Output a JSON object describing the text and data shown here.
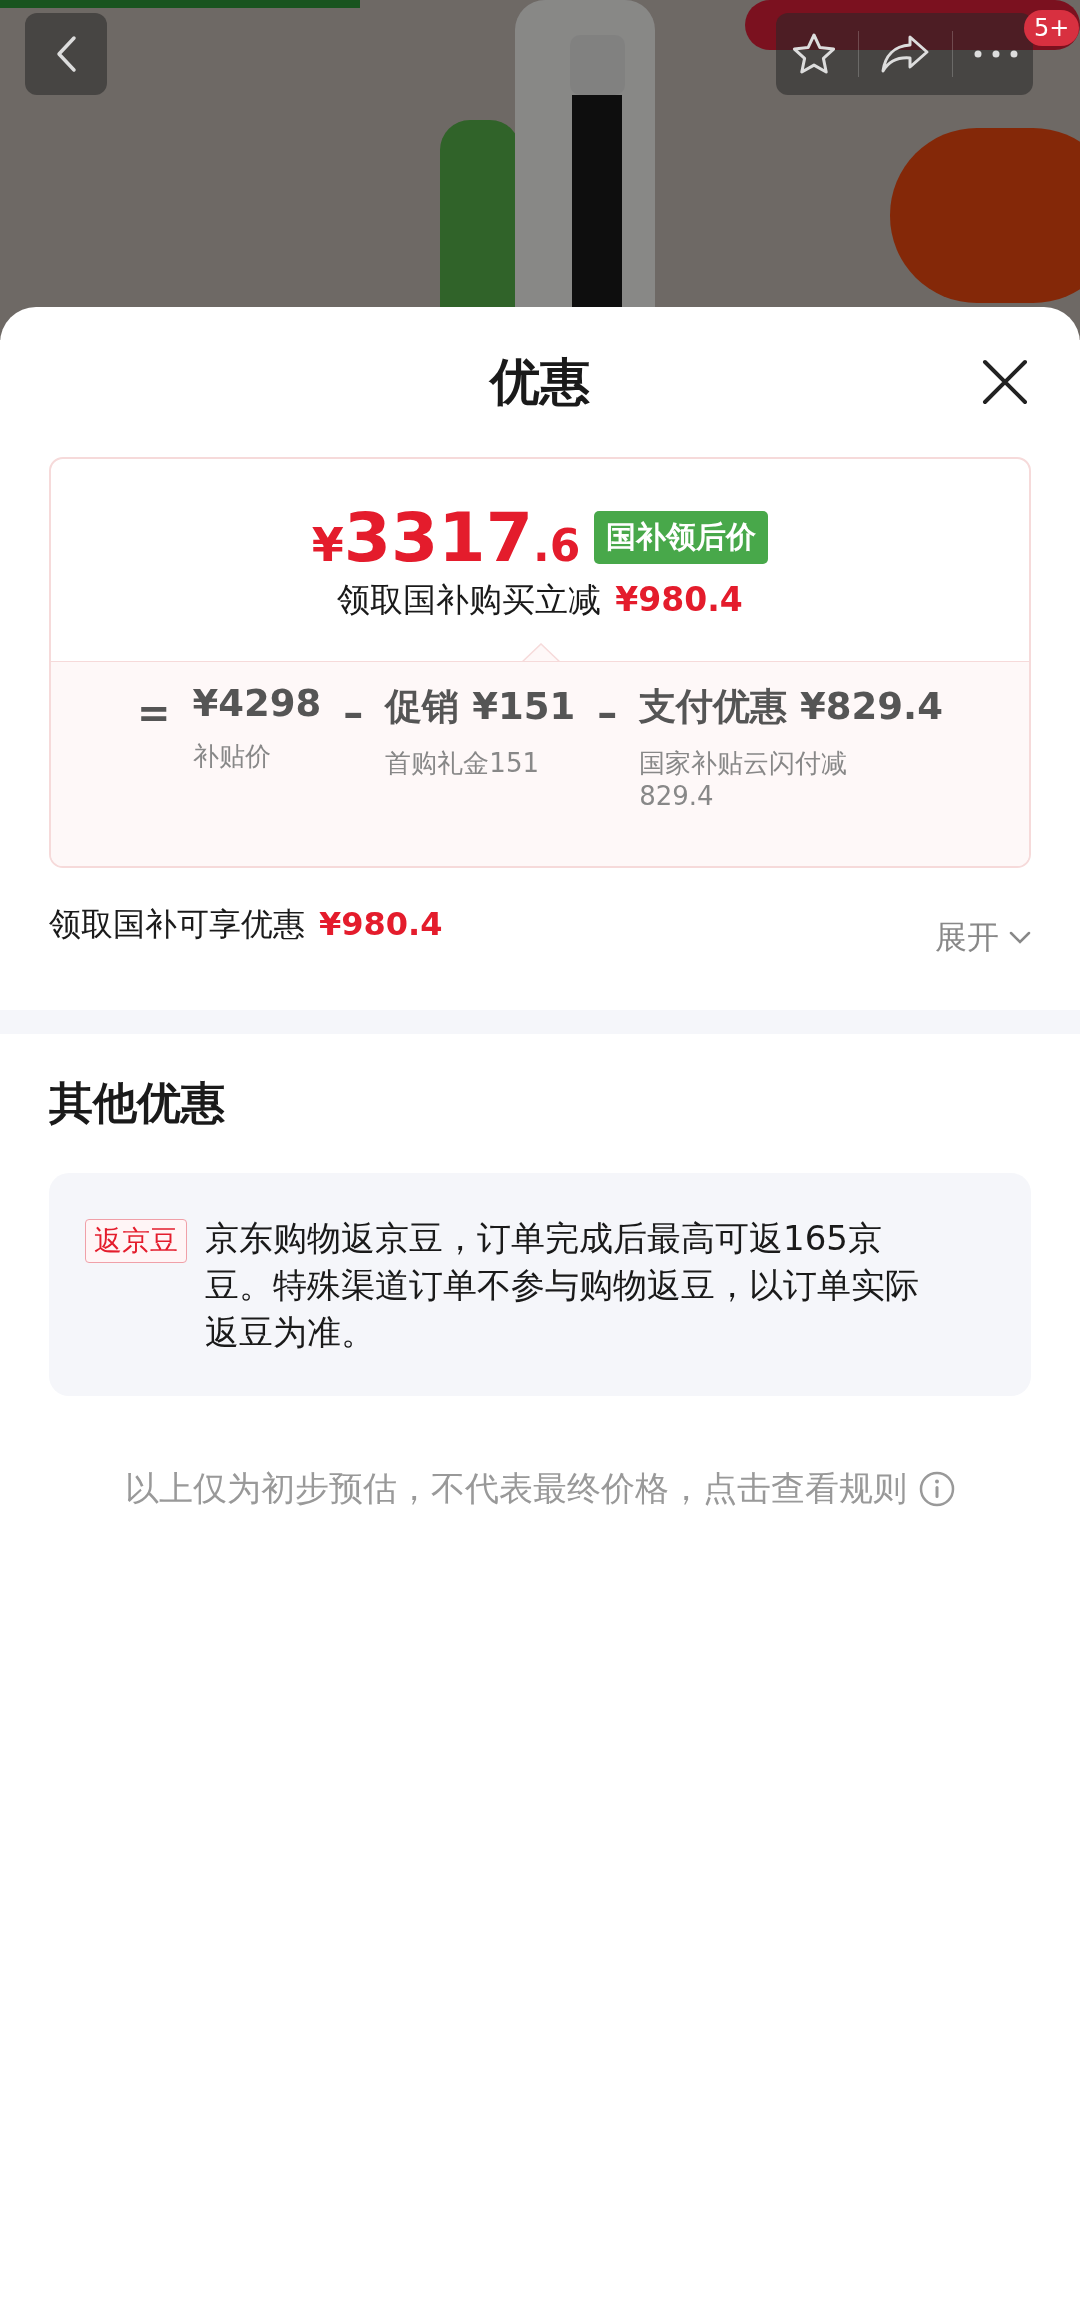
{
  "top_bar": {
    "badge": "5+"
  },
  "sheet": {
    "title": "优惠"
  },
  "price_card": {
    "currency": "¥",
    "price_integer": "3317",
    "price_decimal": ".6",
    "tag": "国补领后价",
    "subtitle": "领取国补购买立减",
    "subtitle_amount": "¥980.4",
    "terms": [
      {
        "operator": "=",
        "value": "¥4298",
        "note": "补贴价"
      },
      {
        "operator": "–",
        "label": "促销",
        "value": "¥151",
        "note": "首购礼金151"
      },
      {
        "operator": "–",
        "label": "支付优惠",
        "value": "¥829.4",
        "note": "国家补贴云闪付减829.4"
      }
    ]
  },
  "summary": {
    "label": "领取国补可享优惠",
    "amount": "¥980.4",
    "toggle": "展开",
    "expanded": false
  },
  "other_offers": {
    "title": "其他优惠",
    "items": [
      {
        "tag": "返京豆",
        "text": "京东购物返京豆，订单完成后最高可返165京豆。特殊渠道订单不参与购物返豆，以订单实际返豆为准。"
      }
    ]
  },
  "disclaimer": "以上仅为初步预估，不代表最终价格，点击查看规则"
}
